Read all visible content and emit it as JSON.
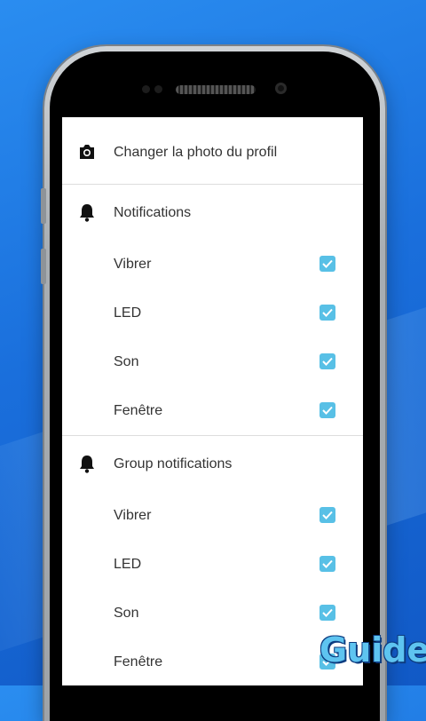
{
  "settings": {
    "profile_photo": {
      "label": "Changer la photo du profil",
      "icon": "camera-icon"
    },
    "notifications": {
      "header": "Notifications",
      "icon": "bell-icon",
      "items": [
        {
          "label": "Vibrer",
          "checked": true
        },
        {
          "label": "LED",
          "checked": true
        },
        {
          "label": "Son",
          "checked": true
        },
        {
          "label": "Fenêtre",
          "checked": true
        }
      ]
    },
    "group_notifications": {
      "header": "Group notifications",
      "icon": "bell-icon",
      "items": [
        {
          "label": "Vibrer",
          "checked": true
        },
        {
          "label": "LED",
          "checked": true
        },
        {
          "label": "Son",
          "checked": true
        },
        {
          "label": "Fenêtre",
          "checked": true
        }
      ]
    }
  },
  "watermark": "Guide",
  "colors": {
    "checkbox": "#58c0e6",
    "background": "#1a6fdc",
    "text": "#333333"
  }
}
